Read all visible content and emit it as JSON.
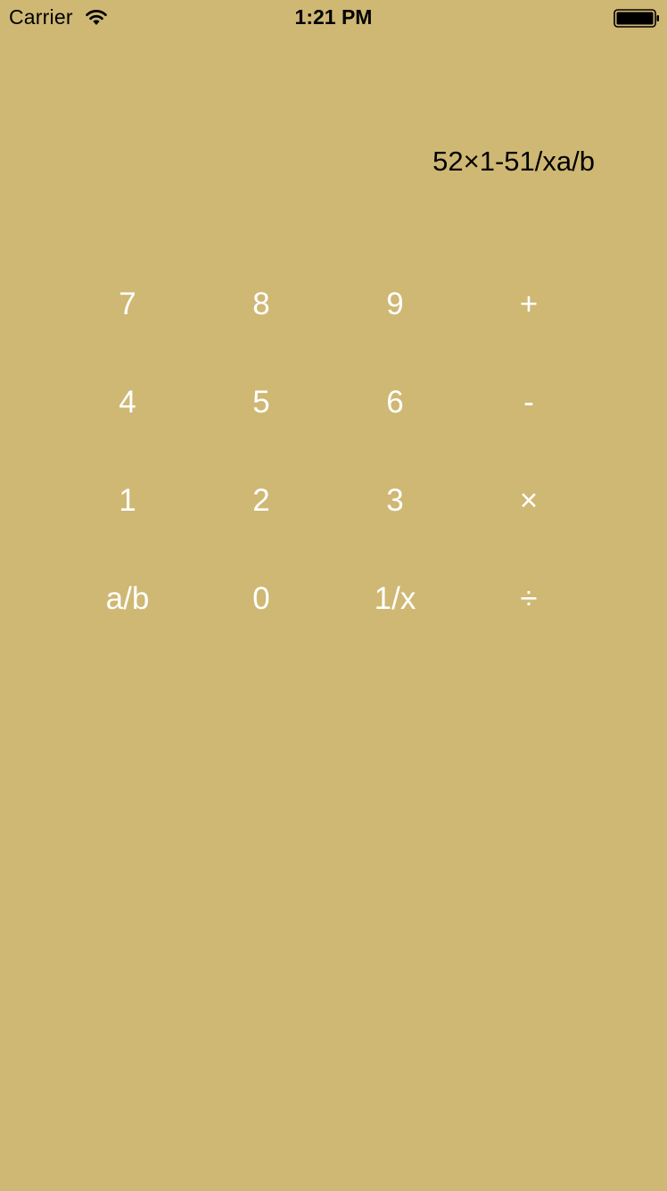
{
  "colors": {
    "background": "#CFB874",
    "key_text": "#FFFFFF",
    "display_text": "#000000"
  },
  "status_bar": {
    "carrier": "Carrier",
    "time": "1:21 PM",
    "wifi_icon": "wifi-icon",
    "battery_icon": "battery-icon",
    "battery_level": 1.0
  },
  "display": {
    "expression": "52×1-51/xa/b"
  },
  "keypad": {
    "rows": [
      [
        "7",
        "8",
        "9",
        "+"
      ],
      [
        "4",
        "5",
        "6",
        "-"
      ],
      [
        "1",
        "2",
        "3",
        "×"
      ],
      [
        "a/b",
        "0",
        "1/x",
        "÷"
      ]
    ]
  }
}
